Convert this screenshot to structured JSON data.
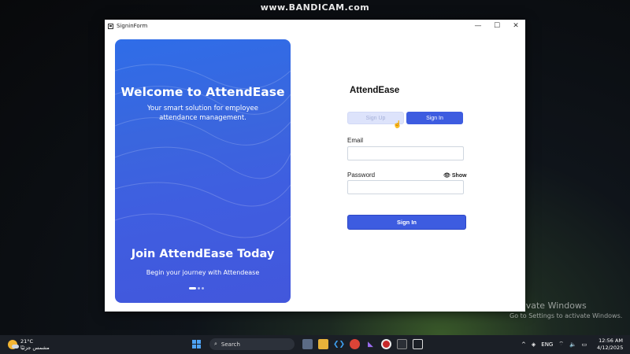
{
  "watermark": "www.BANDICAM.com",
  "window": {
    "title": "SigninForm",
    "controls": {
      "minimize": "—",
      "maximize": "☐",
      "close": "✕"
    }
  },
  "hero": {
    "title": "Welcome to AttendEase",
    "subtitle": "Your smart solution for employee attendance management.",
    "title2": "Join AttendEase Today",
    "subtitle2": "Begin your journey with Attendease",
    "carousel": {
      "count": 3,
      "active_index": 0
    }
  },
  "form": {
    "app_name": "AttendEase",
    "tabs": [
      {
        "label": "Sign Up",
        "active": false
      },
      {
        "label": "Sign In",
        "active": true
      }
    ],
    "email_label": "Email",
    "email_value": "",
    "password_label": "Password",
    "password_value": "",
    "show_label": "Show",
    "submit_label": "Sign In"
  },
  "activation": {
    "line1": "Activate Windows",
    "line2": "Go to Settings to activate Windows."
  },
  "taskbar": {
    "weather_temp": "21°C",
    "weather_desc": "مشمس جزئيًا",
    "search_placeholder": "Search",
    "language": "ENG",
    "time": "12:56 AM",
    "date": "4/12/2025"
  }
}
